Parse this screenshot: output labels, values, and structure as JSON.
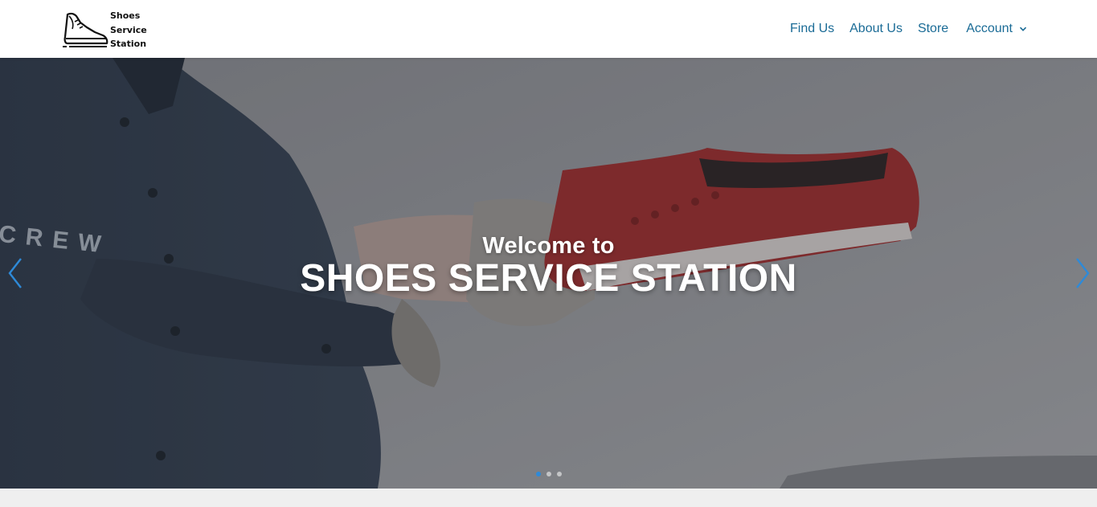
{
  "brand": {
    "logo_lines": [
      "Shoes",
      "Service",
      "Station"
    ]
  },
  "nav": {
    "items": [
      {
        "label": "Find Us"
      },
      {
        "label": "About Us"
      },
      {
        "label": "Store"
      },
      {
        "label": "Account"
      }
    ]
  },
  "hero": {
    "pretitle": "Welcome to",
    "headline": "SHOES SERVICE STATION",
    "background_text": "CREW",
    "slide_count": 3,
    "active_slide": 1
  },
  "colors": {
    "nav_link": "#1a6b96",
    "active_dot": "#2e8ad8",
    "arrow": "#2e8ad8"
  },
  "icons": {
    "logo": "sneaker-icon",
    "dropdown": "chevron-down-icon",
    "prev": "chevron-left-icon",
    "next": "chevron-right-icon"
  }
}
